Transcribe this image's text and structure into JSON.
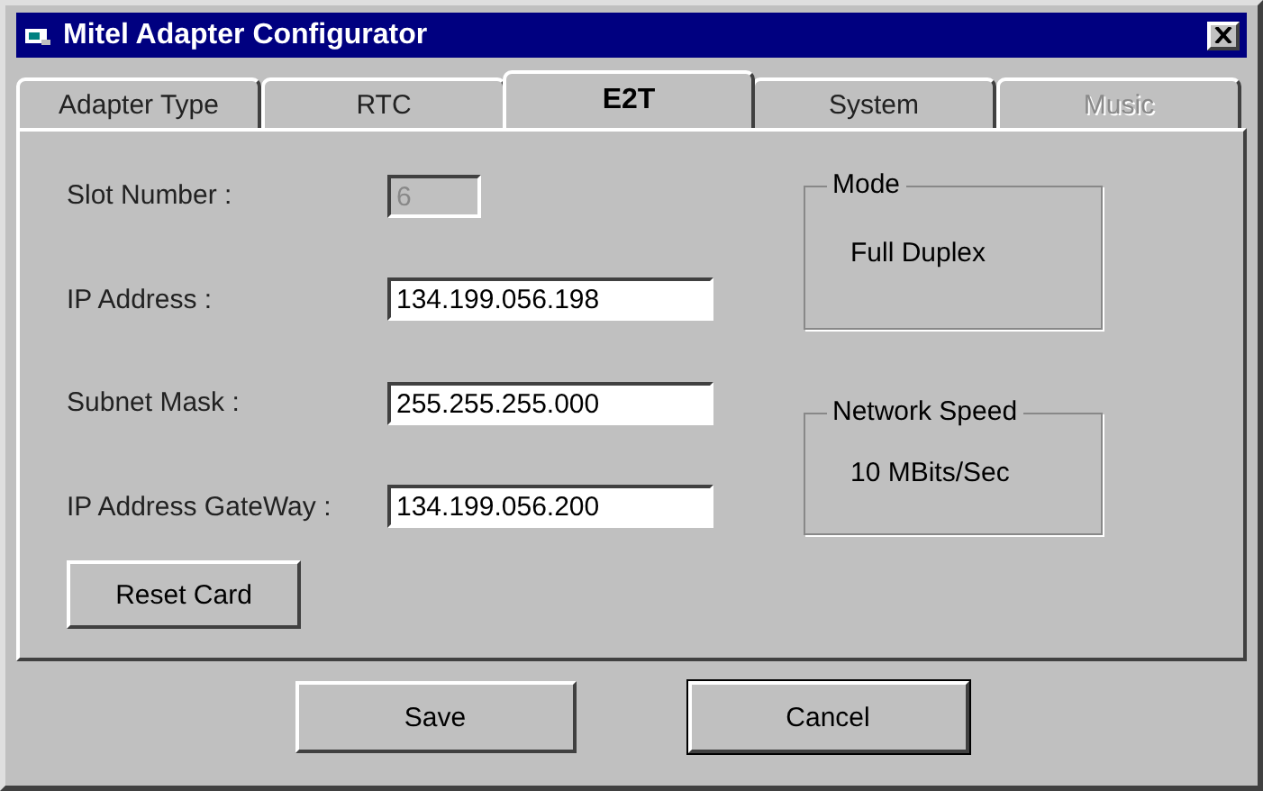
{
  "window": {
    "title": "Mitel Adapter Configurator"
  },
  "tabs": [
    {
      "label": "Adapter Type",
      "selected": false,
      "disabled": false
    },
    {
      "label": "RTC",
      "selected": false,
      "disabled": false
    },
    {
      "label": "E2T",
      "selected": true,
      "disabled": false
    },
    {
      "label": "System",
      "selected": false,
      "disabled": false
    },
    {
      "label": "Music",
      "selected": false,
      "disabled": true
    }
  ],
  "fields": [
    {
      "label": "Slot Number :",
      "value": "6",
      "disabled": true
    },
    {
      "label": "IP Address :",
      "value": "134.199.056.198",
      "disabled": false
    },
    {
      "label": "Subnet Mask :",
      "value": "255.255.255.000",
      "disabled": false
    },
    {
      "label": "IP Address GateWay :",
      "value": "134.199.056.200",
      "disabled": false
    }
  ],
  "groups": [
    {
      "title": "Mode",
      "value": "Full Duplex"
    },
    {
      "title": "Network Speed",
      "value": "10 MBits/Sec"
    }
  ],
  "reset_button": "Reset Card",
  "buttons": [
    {
      "label": "Save",
      "default": false
    },
    {
      "label": "Cancel",
      "default": true
    }
  ]
}
